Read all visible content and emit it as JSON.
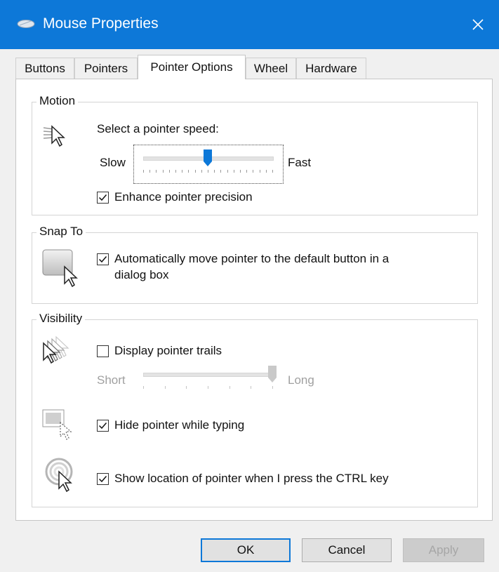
{
  "window": {
    "title": "Mouse Properties"
  },
  "tabs": [
    {
      "label": "Buttons"
    },
    {
      "label": "Pointers"
    },
    {
      "label": "Pointer Options"
    },
    {
      "label": "Wheel"
    },
    {
      "label": "Hardware"
    }
  ],
  "active_tab": "Pointer Options",
  "motion": {
    "group_label": "Motion",
    "speed_prompt": "Select a pointer speed:",
    "slow_label": "Slow",
    "fast_label": "Fast",
    "speed_level": 0.5,
    "enhance_label": "Enhance pointer precision",
    "enhance_checked": true
  },
  "snap_to": {
    "group_label": "Snap To",
    "auto_line1": "Automatically move pointer to the default button in a",
    "auto_line2": "dialog box",
    "auto_checked": true
  },
  "visibility": {
    "group_label": "Visibility",
    "trails_label": "Display pointer trails",
    "trails_checked": false,
    "short_label": "Short",
    "long_label": "Long",
    "trail_length": 1.0,
    "hide_label": "Hide pointer while typing",
    "hide_checked": true,
    "ctrl_label": "Show location of pointer when I press the CTRL key",
    "ctrl_checked": true
  },
  "buttons": {
    "ok": "OK",
    "cancel": "Cancel",
    "apply": "Apply"
  },
  "colors": {
    "accent": "#0d78d8",
    "titlebar": "#0d78d8"
  },
  "icons": [
    "mouse-icon",
    "close-icon",
    "pointer-speed-icon",
    "snap-to-icon",
    "pointer-trails-icon",
    "hide-pointer-icon",
    "ctrl-location-icon",
    "checkmark-icon"
  ]
}
